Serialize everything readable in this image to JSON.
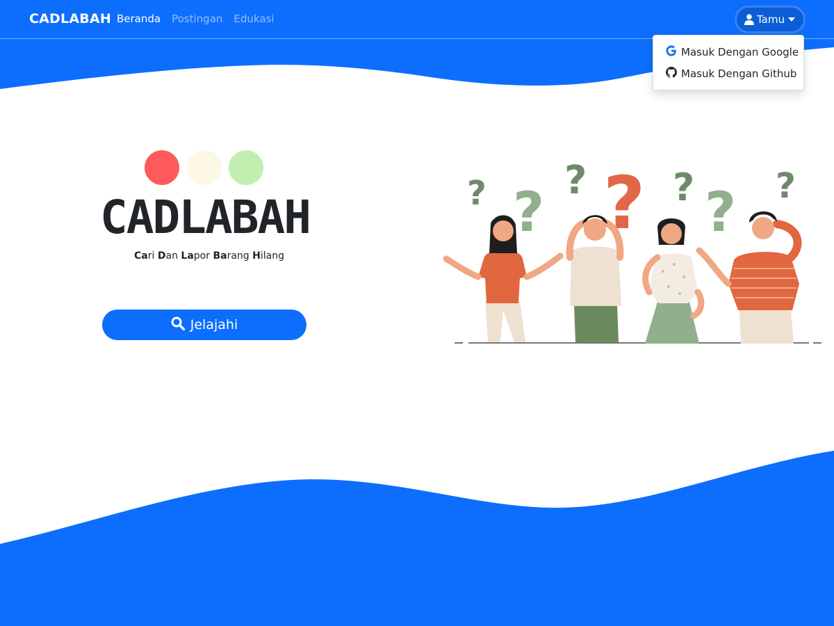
{
  "navbar": {
    "brand": "CADLABAH",
    "links": [
      {
        "label": "Beranda",
        "active": true
      },
      {
        "label": "Postingan",
        "active": false
      },
      {
        "label": "Edukasi",
        "active": false
      }
    ],
    "user_menu": {
      "label": "Tamu",
      "icon": "user-icon",
      "items": [
        {
          "label": "Masuk Dengan Google",
          "icon": "google-icon"
        },
        {
          "label": "Masuk Dengan Github",
          "icon": "github-icon"
        }
      ]
    }
  },
  "hero": {
    "title": "CADLABAH",
    "subtitle_parts": [
      {
        "bold": "Ca",
        "rest": "ri "
      },
      {
        "bold": "D",
        "rest": "an "
      },
      {
        "bold": "La",
        "rest": "por "
      },
      {
        "bold": "Ba",
        "rest": "rang "
      },
      {
        "bold": "H",
        "rest": "ilang"
      }
    ],
    "dots": [
      "#ff5a5a",
      "#fdf8e6",
      "#c2efb0"
    ],
    "explore_button": {
      "label": "Jelajahi",
      "icon": "search-icon"
    }
  },
  "colors": {
    "primary": "#0d6efd",
    "dark_text": "#212529"
  }
}
